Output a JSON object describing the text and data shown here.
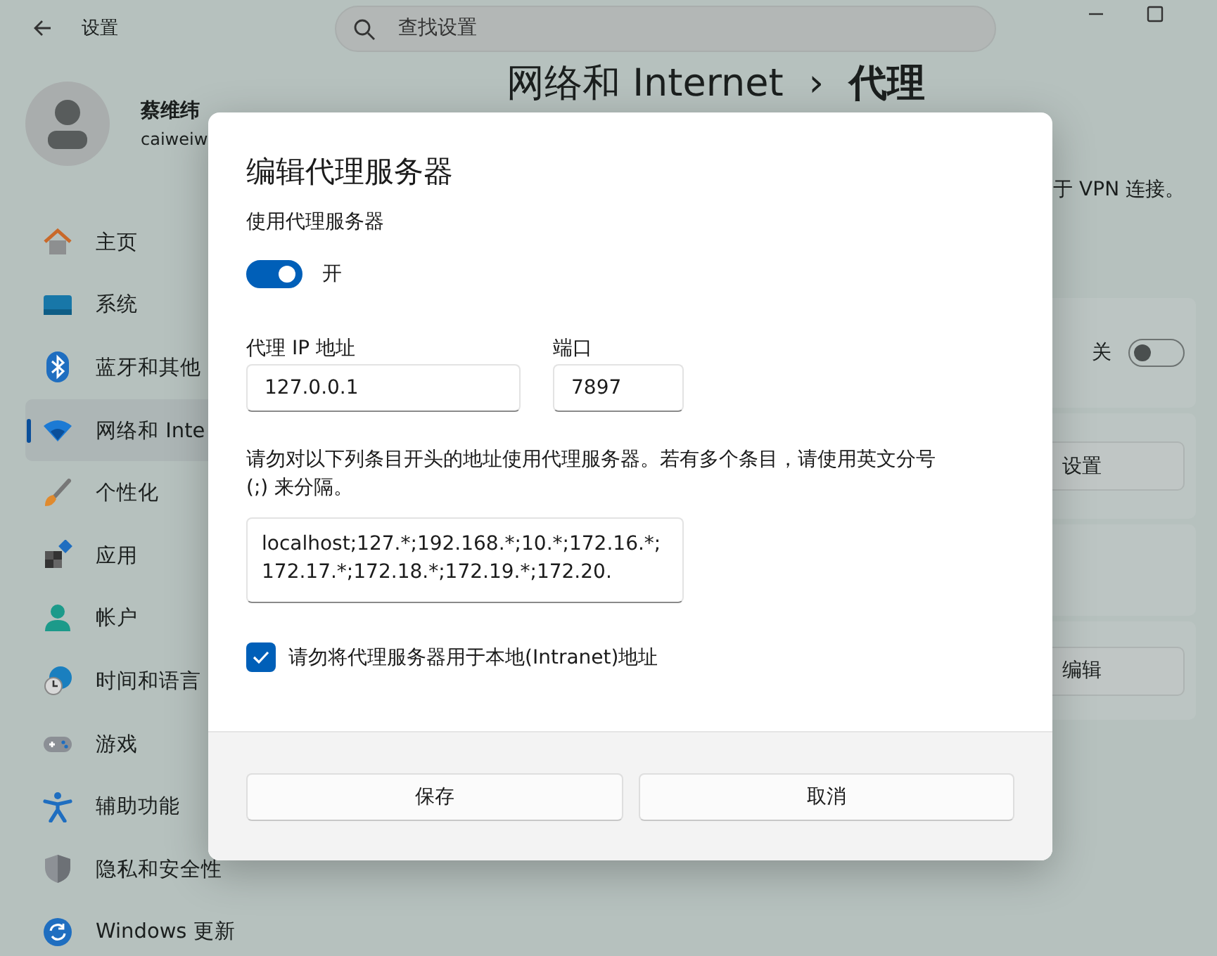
{
  "window": {
    "title": "设置"
  },
  "search": {
    "placeholder": "查找设置"
  },
  "profile": {
    "name": "蔡维纬",
    "email": "caiweiw"
  },
  "sidebar": {
    "items": [
      {
        "label": "主页",
        "selected": false
      },
      {
        "label": "系统",
        "selected": false
      },
      {
        "label": "蓝牙和其他",
        "selected": false
      },
      {
        "label": "网络和 Inte",
        "selected": true
      },
      {
        "label": "个性化",
        "selected": false
      },
      {
        "label": "应用",
        "selected": false
      },
      {
        "label": "帐户",
        "selected": false
      },
      {
        "label": "时间和语言",
        "selected": false
      },
      {
        "label": "游戏",
        "selected": false
      },
      {
        "label": "辅助功能",
        "selected": false
      },
      {
        "label": "隐私和安全性",
        "selected": false
      },
      {
        "label": "Windows 更新",
        "selected": false
      }
    ]
  },
  "page": {
    "breadcrumb": "网络和 Internet",
    "separator": "›",
    "title": "代理",
    "note": "于 VPN 连接。"
  },
  "cards": [
    {
      "kind": "toggle",
      "label": "关",
      "on": false
    },
    {
      "kind": "button",
      "label": "设置"
    },
    {
      "kind": "empty"
    },
    {
      "kind": "button",
      "label": "编辑"
    }
  ],
  "dialog": {
    "title": "编辑代理服务器",
    "proxy_label": "使用代理服务器",
    "proxy_toggle": {
      "label": "开",
      "on": true
    },
    "ip": {
      "label": "代理 IP 地址",
      "value": "127.0.0.1"
    },
    "port": {
      "label": "端口",
      "value": "7897"
    },
    "exceptions_hint": "请勿对以下列条目开头的地址使用代理服务器。若有多个条目，请使用英文分号 (;) 来分隔。",
    "exceptions": "localhost;127.*;192.168.*;10.*;172.16.*;172.17.*;172.18.*;172.19.*;172.20.",
    "local_checkbox": {
      "label": "请勿将代理服务器用于本地(Intranet)地址",
      "checked": true
    },
    "buttons": [
      {
        "label": "保存"
      },
      {
        "label": "取消"
      }
    ]
  }
}
